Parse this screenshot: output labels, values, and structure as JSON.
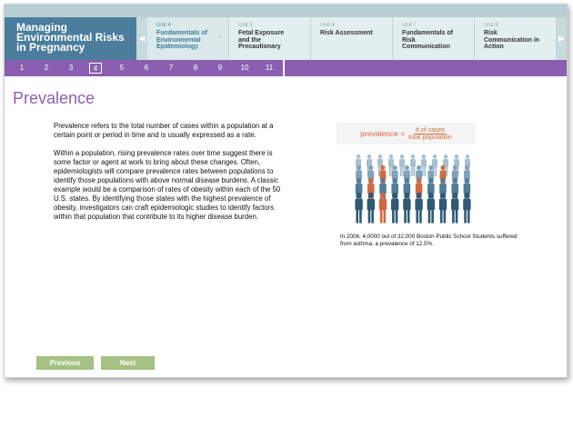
{
  "course": {
    "title_lines": [
      "Managing",
      "Environmental Risks",
      "in Pregnancy"
    ]
  },
  "units": [
    {
      "number": "Unit 4",
      "name_lines": [
        "Fundamentals of",
        "Environmental",
        "Epidemiology"
      ],
      "active": true
    },
    {
      "number": "Unit 5",
      "name_lines": [
        "Fetal Exposure",
        "and the",
        "Precautionary"
      ],
      "active": false
    },
    {
      "number": "Unit 6",
      "name_lines": [
        "Risk Assessment"
      ],
      "active": false
    },
    {
      "number": "Unit 7",
      "name_lines": [
        "Fundamentals of",
        "Risk",
        "Communication"
      ],
      "active": false
    },
    {
      "number": "Unit 8",
      "name_lines": [
        "Risk",
        "Communication in",
        "Action"
      ],
      "active": false
    }
  ],
  "pages": [
    "1",
    "2",
    "3",
    "4",
    "5",
    "6",
    "7",
    "8",
    "9",
    "10",
    "11"
  ],
  "current_page": "4",
  "page_title": "Prevalence",
  "paragraphs": [
    "Prevalence refers to the total number of cases within a population at a certain point or period in time and is usually expressed as a rate.",
    "Within a population, rising prevalence rates over time suggest there is some factor or agent at work to bring about these changes. Often, epidemiologists will compare prevalence rates between populations to identify those populations with above normal disease burdens. A classic example would be a comparison of rates of obesity within each of the 50 U.S. states. By identifying those states with the highest prevalence of obesity, investigators can craft epidemiologic studies to identify factors within that population that contribute to its higher disease burden."
  ],
  "formula": {
    "lhs": "prevalence =",
    "numerator": "# of cases",
    "denominator": "total population"
  },
  "caption": "In 2006, 4,0000 out of 32,000 Boston Public School Students suffered from asthma, a prevalence of 12.5%.",
  "buttons": {
    "previous": "Previous",
    "next": "Next"
  },
  "colors": {
    "accent": "#8a5fb0",
    "header": "#4c7d9c",
    "button": "#a5c183",
    "highlight": "#d06a3d"
  }
}
